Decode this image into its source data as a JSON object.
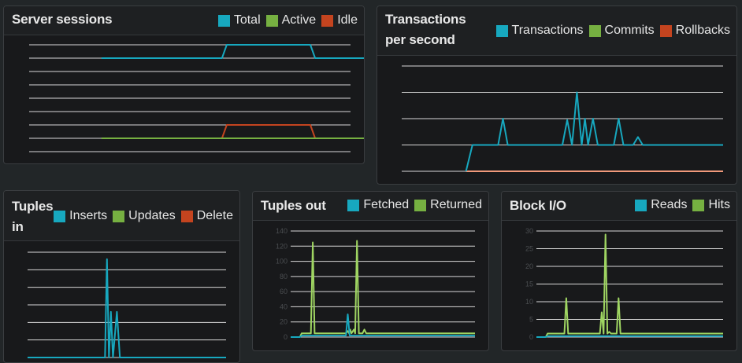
{
  "colors": {
    "blue": "#17a8bf",
    "green": "#76b041",
    "red": "#c4441f",
    "returned": "#9fd562",
    "rollback": "#f0997a"
  },
  "panels": {
    "server_sessions": {
      "title": "Server sessions",
      "legend": [
        {
          "label": "Total",
          "color": "#17a8bf"
        },
        {
          "label": "Active",
          "color": "#76b041"
        },
        {
          "label": "Idle",
          "color": "#c4441f"
        }
      ]
    },
    "transactions": {
      "title_line1": "Transactions",
      "title_line2": "per second",
      "legend": [
        {
          "label": "Transactions",
          "color": "#17a8bf"
        },
        {
          "label": "Commits",
          "color": "#76b041"
        },
        {
          "label": "Rollbacks",
          "color": "#c4441f"
        }
      ]
    },
    "tuples_in": {
      "title_line1": "Tuples",
      "title_line2": "in",
      "legend": [
        {
          "label": "Inserts",
          "color": "#17a8bf"
        },
        {
          "label": "Updates",
          "color": "#76b041"
        },
        {
          "label": "Delete",
          "color": "#c4441f"
        }
      ]
    },
    "tuples_out": {
      "title": "Tuples out",
      "legend": [
        {
          "label": "Fetched",
          "color": "#17a8bf"
        },
        {
          "label": "Returned",
          "color": "#76b041"
        }
      ]
    },
    "block_io": {
      "title": "Block I/O",
      "legend": [
        {
          "label": "Reads",
          "color": "#17a8bf"
        },
        {
          "label": "Hits",
          "color": "#76b041"
        }
      ]
    }
  },
  "chart_data": [
    {
      "id": "server_sessions",
      "type": "line",
      "ylim": [
        0,
        8
      ],
      "grid": true,
      "xlim": [
        0,
        40
      ],
      "series": [
        {
          "name": "Total",
          "color": "#17a8bf",
          "points": [
            [
              9,
              7
            ],
            [
              24,
              7
            ],
            [
              24.6,
              8
            ],
            [
              35,
              8
            ],
            [
              35.6,
              7
            ],
            [
              49,
              7
            ]
          ]
        },
        {
          "name": "Idle",
          "color": "#c4441f",
          "points": [
            [
              24,
              1
            ],
            [
              24.6,
              2
            ],
            [
              35,
              2
            ],
            [
              35.6,
              1
            ]
          ]
        },
        {
          "name": "Active",
          "color": "#76b041",
          "points": [
            [
              9,
              1
            ],
            [
              49,
              1
            ]
          ]
        }
      ]
    },
    {
      "id": "transactions",
      "type": "line",
      "ylim": [
        0,
        4
      ],
      "grid": true,
      "xlim": [
        0,
        100
      ],
      "series": [
        {
          "name": "Rollbacks",
          "color": "#f0997a",
          "points": [
            [
              20,
              0
            ],
            [
              100,
              0
            ]
          ]
        },
        {
          "name": "Transactions",
          "color": "#17a8bf",
          "points": [
            [
              20,
              0
            ],
            [
              22,
              1
            ],
            [
              30,
              1
            ],
            [
              31.5,
              2
            ],
            [
              33,
              1
            ],
            [
              50,
              1
            ],
            [
              51.5,
              1.95
            ],
            [
              53,
              1
            ],
            [
              54.5,
              3
            ],
            [
              56,
              1
            ],
            [
              57,
              2
            ],
            [
              58,
              1
            ],
            [
              59.5,
              2
            ],
            [
              61,
              1
            ],
            [
              66,
              1
            ],
            [
              67.5,
              2
            ],
            [
              69,
              1
            ],
            [
              72,
              1
            ],
            [
              73.5,
              1.3
            ],
            [
              75,
              1
            ],
            [
              100,
              1
            ]
          ]
        }
      ]
    },
    {
      "id": "tuples_in",
      "type": "line",
      "ylim": [
        0,
        6
      ],
      "grid": true,
      "xlim": [
        0,
        100
      ],
      "series": [
        {
          "name": "Inserts",
          "color": "#17a8bf",
          "points": [
            [
              0,
              0
            ],
            [
              39,
              0
            ],
            [
              40,
              5.6
            ],
            [
              41,
              0
            ],
            [
              42,
              2.6
            ],
            [
              43,
              0
            ],
            [
              45,
              2.6
            ],
            [
              46.5,
              0
            ],
            [
              100,
              0
            ]
          ]
        }
      ]
    },
    {
      "id": "tuples_out",
      "type": "line",
      "ylim": [
        0,
        140
      ],
      "grid": true,
      "xlim": [
        0,
        100
      ],
      "yticks": [
        0,
        20,
        40,
        60,
        80,
        100,
        120,
        140
      ],
      "series": [
        {
          "name": "Returned",
          "color": "#9fd562",
          "points": [
            [
              0,
              0
            ],
            [
              5,
              0
            ],
            [
              6,
              5
            ],
            [
              11,
              5
            ],
            [
              12,
              125
            ],
            [
              13,
              5
            ],
            [
              30,
              5
            ],
            [
              31,
              8
            ],
            [
              31.7,
              5
            ],
            [
              32.3,
              10
            ],
            [
              33,
              5
            ],
            [
              34.3,
              10
            ],
            [
              35,
              5
            ],
            [
              36,
              127
            ],
            [
              37,
              5
            ],
            [
              39,
              5
            ],
            [
              40,
              10
            ],
            [
              41,
              5
            ],
            [
              100,
              5
            ]
          ]
        },
        {
          "name": "Fetched",
          "color": "#17a8bf",
          "points": [
            [
              0,
              0
            ],
            [
              5,
              0
            ],
            [
              6,
              2
            ],
            [
              30,
              2
            ],
            [
              31,
              30
            ],
            [
              32,
              2
            ],
            [
              100,
              2
            ]
          ]
        }
      ]
    },
    {
      "id": "block_io",
      "type": "line",
      "ylim": [
        0,
        30
      ],
      "grid": true,
      "xlim": [
        0,
        100
      ],
      "yticks": [
        0,
        5,
        10,
        15,
        20,
        25,
        30
      ],
      "series": [
        {
          "name": "Hits",
          "color": "#9fd562",
          "points": [
            [
              0,
              0
            ],
            [
              5,
              0
            ],
            [
              6,
              1
            ],
            [
              15,
              1
            ],
            [
              16,
              11
            ],
            [
              17,
              1
            ],
            [
              34,
              1
            ],
            [
              35,
              7
            ],
            [
              36,
              1
            ],
            [
              37,
              29
            ],
            [
              38,
              1
            ],
            [
              39,
              1.5
            ],
            [
              40,
              1
            ],
            [
              43,
              1
            ],
            [
              44,
              11
            ],
            [
              45,
              1
            ],
            [
              100,
              1
            ]
          ]
        },
        {
          "name": "Reads",
          "color": "#17a8bf",
          "points": [
            [
              0,
              0
            ],
            [
              5,
              0
            ],
            [
              6,
              0.3
            ],
            [
              100,
              0.3
            ]
          ]
        }
      ]
    }
  ]
}
